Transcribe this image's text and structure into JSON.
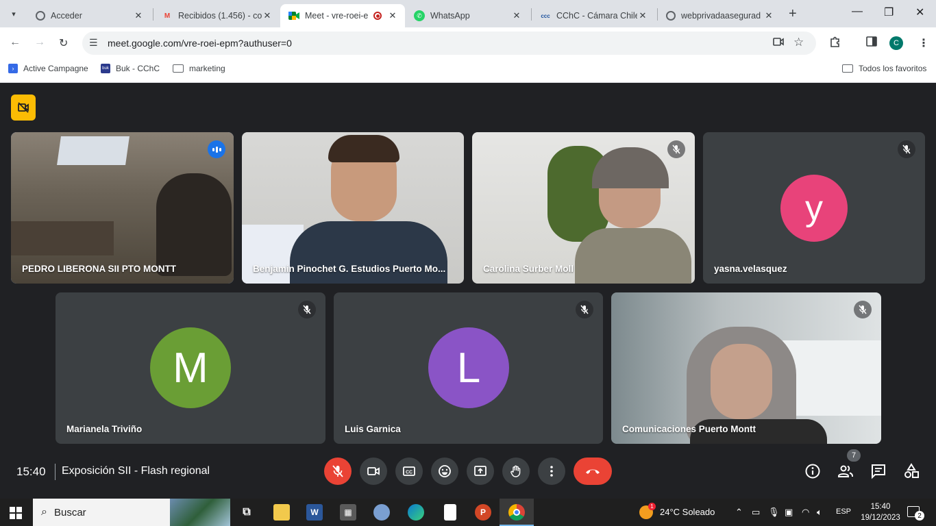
{
  "browser": {
    "tabs": [
      {
        "title": "Acceder",
        "icon": "google-icon"
      },
      {
        "title": "Recibidos (1.456) - co",
        "icon": "gmail-icon"
      },
      {
        "title": "Meet - vre-roei-e",
        "icon": "meet-icon",
        "active": true,
        "recording": true
      },
      {
        "title": "WhatsApp",
        "icon": "whatsapp-icon"
      },
      {
        "title": "CChC - Cámara Chile",
        "icon": "cchc-icon"
      },
      {
        "title": "webprivadaasegurad",
        "icon": "globe-icon"
      }
    ],
    "url": "meet.google.com/vre-roei-epm?authuser=0",
    "profile_initial": "C",
    "bookmarks": [
      {
        "label": "Active Campagne",
        "icon": "activecampaign-icon"
      },
      {
        "label": "Buk - CChC",
        "icon": "buk-icon",
        "icon_text": "buk"
      },
      {
        "label": "marketing",
        "icon": "folder-icon"
      }
    ],
    "all_bookmarks_label": "Todos los favoritos"
  },
  "meet": {
    "time": "15:40",
    "title": "Exposición SII - Flash regional",
    "participant_count": "7",
    "participants": [
      {
        "name": "PEDRO LIBERONA SII PTO MONTT",
        "speaking": true
      },
      {
        "name": "Benjamin Pinochet G. Estudios Puerto Mo..."
      },
      {
        "name": "Carolina Surber Moll",
        "muted": true
      },
      {
        "name": "yasna.velasquez",
        "muted": true,
        "avatar_letter": "y",
        "avatar_color": "#e8437a"
      },
      {
        "name": "Marianela Triviño",
        "muted": true,
        "avatar_letter": "M",
        "avatar_color": "#6a9e35"
      },
      {
        "name": "Luis Garnica",
        "muted": true,
        "avatar_letter": "L",
        "avatar_color": "#8a54c6"
      },
      {
        "name": "Comunicaciones Puerto Montt",
        "muted": true
      }
    ]
  },
  "taskbar": {
    "search_label": "Buscar",
    "weather": "24°C  Soleado",
    "weather_badge": "1",
    "lang": "ESP",
    "time": "15:40",
    "date": "19/12/2023",
    "notifications": "2"
  }
}
